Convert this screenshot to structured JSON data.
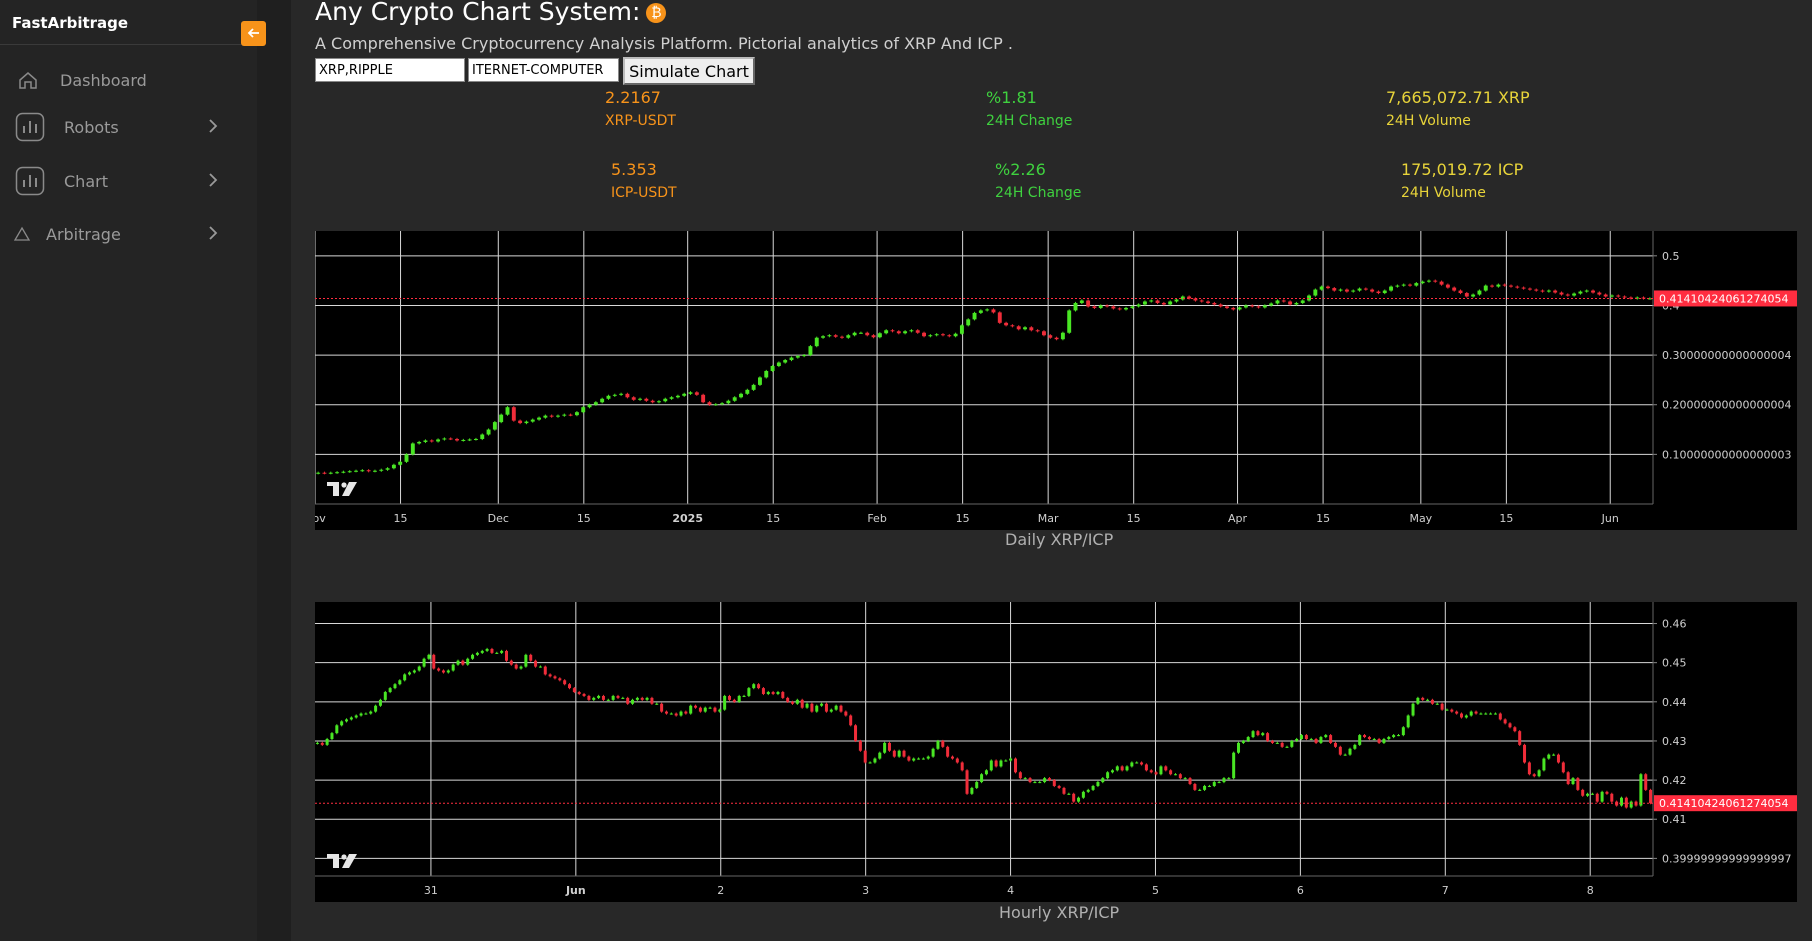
{
  "app": {
    "brand": "FastArbitrage"
  },
  "sidebar": {
    "items": [
      {
        "label": "Dashboard",
        "icon": "home-icon"
      },
      {
        "label": "Robots",
        "icon": "bar-chart-icon"
      },
      {
        "label": "Chart",
        "icon": "bar-chart-icon"
      },
      {
        "label": "Arbitrage",
        "icon": "triangle-icon"
      }
    ]
  },
  "header": {
    "title": "Any Crypto Chart System:",
    "subtitle": "A Comprehensive Cryptocurrency Analysis Platform. Pictorial analytics of XRP And ICP ."
  },
  "controls": {
    "coin1_value": "XRP,RIPPLE",
    "coin2_value": "ITERNET-COMPUTER",
    "simulate_label": "Simulate Chart"
  },
  "stats": {
    "xrp": {
      "price": "2.2167",
      "pair": "XRP-USDT",
      "change": "%1.81",
      "change_label": "24H Change",
      "volume": "7,665,072.71 XRP",
      "volume_label": "24H Volume"
    },
    "icp": {
      "price": "5.353",
      "pair": "ICP-USDT",
      "change": "%2.26",
      "change_label": "24H Change",
      "volume": "175,019.72 ICP",
      "volume_label": "24H Volume"
    }
  },
  "colors": {
    "accent": "#f7931a",
    "up": "#49e624",
    "down": "#f02d3a",
    "price_line": "#ff2d40"
  },
  "chart_data": [
    {
      "type": "candlestick",
      "title": "Daily XRP/ICP",
      "current_price_label": "0.41410424061274054",
      "current_price": 0.4141,
      "ylim": [
        0,
        0.55
      ],
      "y_ticks": [
        0.5,
        0.4,
        0.3,
        0.2,
        0.1
      ],
      "y_tick_labels": [
        "0.5",
        "0.4",
        "0.30000000000000004",
        "0.20000000000000004",
        "0.10000000000000003"
      ],
      "x_ticks": [
        {
          "label": "Nov",
          "t": 0,
          "bold": false
        },
        {
          "label": "15",
          "t": 14,
          "bold": false
        },
        {
          "label": "Dec",
          "t": 30,
          "bold": false
        },
        {
          "label": "15",
          "t": 44,
          "bold": false
        },
        {
          "label": "2025",
          "t": 61,
          "bold": true
        },
        {
          "label": "15",
          "t": 75,
          "bold": false
        },
        {
          "label": "Feb",
          "t": 92,
          "bold": false
        },
        {
          "label": "15",
          "t": 106,
          "bold": false
        },
        {
          "label": "Mar",
          "t": 120,
          "bold": false
        },
        {
          "label": "15",
          "t": 134,
          "bold": false
        },
        {
          "label": "Apr",
          "t": 151,
          "bold": false
        },
        {
          "label": "15",
          "t": 165,
          "bold": false
        },
        {
          "label": "May",
          "t": 181,
          "bold": false
        },
        {
          "label": "15",
          "t": 195,
          "bold": false
        },
        {
          "label": "Jun",
          "t": 212,
          "bold": false
        }
      ],
      "x_range": [
        0,
        219
      ],
      "closes": [
        0.063,
        0.062,
        0.063,
        0.064,
        0.065,
        0.066,
        0.067,
        0.068,
        0.066,
        0.067,
        0.069,
        0.072,
        0.079,
        0.085,
        0.1,
        0.122,
        0.125,
        0.128,
        0.126,
        0.13,
        0.132,
        0.131,
        0.128,
        0.129,
        0.13,
        0.131,
        0.14,
        0.15,
        0.165,
        0.18,
        0.195,
        0.168,
        0.163,
        0.166,
        0.17,
        0.174,
        0.178,
        0.176,
        0.178,
        0.18,
        0.179,
        0.185,
        0.195,
        0.2,
        0.205,
        0.212,
        0.218,
        0.22,
        0.222,
        0.215,
        0.21,
        0.212,
        0.208,
        0.205,
        0.207,
        0.212,
        0.215,
        0.218,
        0.222,
        0.225,
        0.22,
        0.205,
        0.2,
        0.201,
        0.203,
        0.208,
        0.215,
        0.222,
        0.23,
        0.24,
        0.255,
        0.268,
        0.278,
        0.285,
        0.29,
        0.295,
        0.298,
        0.3,
        0.318,
        0.335,
        0.338,
        0.34,
        0.337,
        0.335,
        0.34,
        0.345,
        0.345,
        0.34,
        0.336,
        0.344,
        0.35,
        0.348,
        0.344,
        0.348,
        0.35,
        0.345,
        0.338,
        0.34,
        0.342,
        0.34,
        0.338,
        0.343,
        0.36,
        0.372,
        0.385,
        0.39,
        0.392,
        0.386,
        0.365,
        0.36,
        0.358,
        0.352,
        0.356,
        0.35,
        0.348,
        0.34,
        0.335,
        0.332,
        0.345,
        0.39,
        0.405,
        0.41,
        0.398,
        0.395,
        0.4,
        0.398,
        0.394,
        0.392,
        0.395,
        0.398,
        0.402,
        0.408,
        0.41,
        0.405,
        0.402,
        0.408,
        0.412,
        0.418,
        0.414,
        0.41,
        0.408,
        0.405,
        0.402,
        0.398,
        0.395,
        0.392,
        0.396,
        0.4,
        0.398,
        0.396,
        0.4,
        0.404,
        0.41,
        0.408,
        0.402,
        0.405,
        0.41,
        0.42,
        0.432,
        0.438,
        0.435,
        0.43,
        0.432,
        0.428,
        0.43,
        0.434,
        0.432,
        0.428,
        0.425,
        0.43,
        0.438,
        0.44,
        0.442,
        0.44,
        0.445,
        0.448,
        0.45,
        0.448,
        0.442,
        0.436,
        0.43,
        0.425,
        0.418,
        0.422,
        0.43,
        0.44,
        0.438,
        0.442,
        0.44,
        0.438,
        0.436,
        0.434,
        0.432,
        0.43,
        0.428,
        0.43,
        0.426,
        0.422,
        0.42,
        0.424,
        0.428,
        0.43,
        0.426,
        0.422,
        0.418,
        0.42,
        0.418,
        0.416,
        0.414,
        0.416,
        0.414,
        0.4141
      ]
    },
    {
      "type": "candlestick",
      "title": "Hourly XRP/ICP",
      "current_price_label": "0.41410424061274054",
      "current_price": 0.4141,
      "ylim": [
        0.3955,
        0.4655
      ],
      "y_ticks": [
        0.46,
        0.45,
        0.44,
        0.43,
        0.42,
        0.41,
        0.4
      ],
      "y_tick_labels": [
        "0.46",
        "0.45",
        "0.44",
        "0.43",
        "0.42",
        "0.41",
        "0.39999999999999997"
      ],
      "x_ticks": [
        {
          "label": "31",
          "t": 24,
          "bold": false
        },
        {
          "label": "Jun",
          "t": 54,
          "bold": true
        },
        {
          "label": "2",
          "t": 84,
          "bold": false
        },
        {
          "label": "3",
          "t": 114,
          "bold": false
        },
        {
          "label": "4",
          "t": 144,
          "bold": false
        },
        {
          "label": "5",
          "t": 174,
          "bold": false
        },
        {
          "label": "6",
          "t": 204,
          "bold": false
        },
        {
          "label": "7",
          "t": 234,
          "bold": false
        },
        {
          "label": "8",
          "t": 264,
          "bold": false
        }
      ],
      "x_range": [
        0,
        277
      ],
      "closes": [
        0.4295,
        0.429,
        0.4305,
        0.432,
        0.434,
        0.435,
        0.4355,
        0.436,
        0.4365,
        0.437,
        0.437,
        0.4375,
        0.439,
        0.4405,
        0.4425,
        0.4435,
        0.4445,
        0.4455,
        0.447,
        0.4475,
        0.448,
        0.449,
        0.451,
        0.452,
        0.4485,
        0.448,
        0.4475,
        0.448,
        0.4495,
        0.4505,
        0.4495,
        0.451,
        0.452,
        0.4525,
        0.453,
        0.4535,
        0.4525,
        0.4525,
        0.453,
        0.4505,
        0.4495,
        0.4485,
        0.449,
        0.452,
        0.4505,
        0.449,
        0.449,
        0.447,
        0.4465,
        0.446,
        0.4455,
        0.4445,
        0.4435,
        0.4425,
        0.442,
        0.4415,
        0.4405,
        0.441,
        0.4415,
        0.4405,
        0.4405,
        0.4415,
        0.441,
        0.441,
        0.4395,
        0.4405,
        0.441,
        0.4405,
        0.441,
        0.4395,
        0.4395,
        0.4375,
        0.437,
        0.437,
        0.4365,
        0.4375,
        0.437,
        0.439,
        0.4385,
        0.4375,
        0.4385,
        0.4385,
        0.4375,
        0.438,
        0.4415,
        0.4405,
        0.44,
        0.4415,
        0.4415,
        0.4435,
        0.4445,
        0.4435,
        0.442,
        0.4425,
        0.442,
        0.4425,
        0.441,
        0.44,
        0.4395,
        0.4405,
        0.4385,
        0.4395,
        0.4375,
        0.439,
        0.4395,
        0.4375,
        0.438,
        0.439,
        0.4375,
        0.4365,
        0.434,
        0.43,
        0.4275,
        0.4245,
        0.4245,
        0.4255,
        0.427,
        0.4295,
        0.4275,
        0.426,
        0.4275,
        0.426,
        0.425,
        0.4255,
        0.4255,
        0.4255,
        0.426,
        0.428,
        0.43,
        0.4285,
        0.426,
        0.4255,
        0.4245,
        0.4225,
        0.4165,
        0.418,
        0.4195,
        0.4215,
        0.4225,
        0.425,
        0.4235,
        0.425,
        0.425,
        0.4255,
        0.422,
        0.4205,
        0.4205,
        0.4195,
        0.4195,
        0.4195,
        0.4205,
        0.42,
        0.4185,
        0.418,
        0.4165,
        0.4165,
        0.4145,
        0.4155,
        0.417,
        0.4175,
        0.4185,
        0.4195,
        0.4205,
        0.422,
        0.4225,
        0.4235,
        0.4225,
        0.4235,
        0.4245,
        0.4245,
        0.424,
        0.4225,
        0.422,
        0.4215,
        0.4235,
        0.4225,
        0.4215,
        0.4215,
        0.4205,
        0.4205,
        0.419,
        0.4175,
        0.4175,
        0.4185,
        0.4185,
        0.4195,
        0.4195,
        0.4205,
        0.4205,
        0.427,
        0.4295,
        0.43,
        0.431,
        0.4325,
        0.4315,
        0.432,
        0.43,
        0.4295,
        0.4295,
        0.4285,
        0.4285,
        0.43,
        0.4305,
        0.4315,
        0.4305,
        0.4305,
        0.4295,
        0.431,
        0.4315,
        0.4295,
        0.4285,
        0.4265,
        0.4265,
        0.428,
        0.429,
        0.4315,
        0.431,
        0.4305,
        0.4305,
        0.4295,
        0.4305,
        0.431,
        0.4315,
        0.4315,
        0.4335,
        0.4365,
        0.4395,
        0.441,
        0.4405,
        0.4405,
        0.4395,
        0.4395,
        0.438,
        0.438,
        0.4375,
        0.437,
        0.436,
        0.4365,
        0.4375,
        0.437,
        0.437,
        0.437,
        0.437,
        0.437,
        0.4355,
        0.4345,
        0.4335,
        0.4325,
        0.429,
        0.4245,
        0.4215,
        0.421,
        0.4225,
        0.4255,
        0.4265,
        0.4265,
        0.4245,
        0.422,
        0.419,
        0.4205,
        0.4175,
        0.416,
        0.4165,
        0.4165,
        0.4145,
        0.417,
        0.4165,
        0.4145,
        0.4135,
        0.4155,
        0.413,
        0.4145,
        0.4135,
        0.4215,
        0.4175,
        0.4141
      ]
    }
  ]
}
